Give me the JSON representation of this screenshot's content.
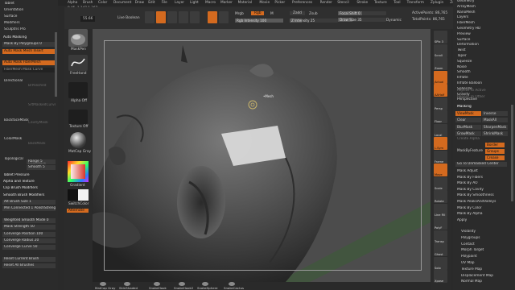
{
  "menu": [
    "Alpha",
    "Brush",
    "Color",
    "Document",
    "Draw",
    "Edit",
    "File",
    "Layer",
    "Light",
    "Macro",
    "Marker",
    "Material",
    "Movie",
    "Picker",
    "Preferences",
    "Render",
    "Stencil",
    "Stroke",
    "Texture",
    "Tool",
    "Transform",
    "Zplugin",
    "Zscript"
  ],
  "coords": "0.45 ·1.147,1.367",
  "topbar": {
    "value_box": "55.66",
    "live_boolean": "Live Boolean",
    "mrgb": "Mrgb",
    "rgb": "Rgb",
    "m": "M",
    "rgb_intensity": "Rgb Intensity 100",
    "zadd": "Zadd",
    "zsub": "Zsub",
    "z_intensity": "Z Intensity 25",
    "focal_shift": "Focal Shift 0",
    "draw_size": "Draw Size 35",
    "dynamic": "Dynamic",
    "active_points": "ActivePoints: 86,765",
    "total_points": "TotalPoints: 86,765"
  },
  "left_panel": {
    "rows": [
      {
        "label": "Tablet",
        "style": "plain"
      },
      {
        "label": "Orientation",
        "style": "plain"
      },
      {
        "label": "Surface",
        "style": "plain"
      },
      {
        "label": "Modifiers",
        "style": "plain"
      },
      {
        "label": "Sculptris Pro",
        "style": "plain"
      },
      {
        "label": "Auto Masking",
        "style": "sep"
      },
      {
        "label": "Mask By Polygroups 0",
        "style": "bar"
      },
      {
        "label": "Auto Mask Mesh Insert",
        "style": "orange"
      },
      {
        "label": "Auto Mask FiberMesh",
        "style": "orange"
      },
      {
        "label": "FiberMesh Mask Curve",
        "style": "dark"
      },
      {
        "label": "Directional",
        "style": "plain"
      },
      {
        "label": "BackfaceMask",
        "style": "plain"
      },
      {
        "label": "ColorMask",
        "style": "plain"
      },
      {
        "label": "Topological",
        "style": "plain"
      },
      {
        "label": "Range 5",
        "style": "bar"
      },
      {
        "label": "Smooth 5",
        "style": "bar"
      },
      {
        "label": "Tablet Pressure",
        "style": "sep"
      },
      {
        "label": "Alpha and Texture",
        "style": "sep"
      },
      {
        "label": "Clip Brush Modifiers",
        "style": "sep"
      },
      {
        "label": "Smooth Brush Modifiers",
        "style": "sep"
      },
      {
        "label": "Alt Brush Size 1",
        "style": "bar"
      },
      {
        "label": "Min Connected 1 PolishStrength",
        "style": "bar"
      },
      {
        "label": "Weighted Smooth Mode 0",
        "style": "bar"
      },
      {
        "label": "Mask Strength 50",
        "style": "bar"
      },
      {
        "label": "Converge Position 100",
        "style": "bar"
      },
      {
        "label": "Converge Radius 20",
        "style": "bar"
      },
      {
        "label": "Converge Curve 50",
        "style": "bar"
      },
      {
        "label": "Reset Current Brush",
        "style": "bar"
      },
      {
        "label": "Reset All Brushes",
        "style": "bar"
      }
    ],
    "dim_labels": [
      "BrPolished",
      "SrtMaskedCurve",
      "CavityMask",
      "BackMask",
      "ColorMask"
    ]
  },
  "shelf": {
    "brush_label": "MaskPen",
    "stroke_label": "FreeHand",
    "alpha_label": "Alpha Off",
    "texture_label": "Texture Off",
    "material_label": "MatCap Gray",
    "gradient_label": "Gradient",
    "switch_label": "SwitchColor",
    "alternate_label": "Alternate"
  },
  "viewport": {
    "cursor_label": "•Mesh"
  },
  "right_shelf": {
    "buttons": [
      "SPix 3",
      "Scroll",
      "Zoom",
      "Actual",
      "AAHalf",
      "Persp",
      "Floor",
      "Local",
      "L.Sym",
      "Frame",
      "Move",
      "Scale",
      "Rotate",
      "Line Fill",
      "PolyF",
      "Transp",
      "Ghost",
      "Solo",
      "Xpose"
    ]
  },
  "right_panel": {
    "top_rows": [
      "Geometry",
      "ArrayMesh",
      "NanoMesh",
      "Layers",
      "FiberMesh",
      "Geometry HD",
      "Preview",
      "Surface",
      "Deformation",
      "Twist",
      "Taper",
      "Squeeze",
      "Noise",
      "Smooth",
      "Inflate",
      "Inflate Balloon",
      "Spherize",
      "Gravity",
      "Perspective"
    ],
    "repair_rows": [
      "Repeat To Active",
      "Repeat To Other"
    ],
    "masking_header": "Masking",
    "mask_buttons": [
      {
        "left": "ViewMask",
        "right": "Inverse",
        "left_active": true
      },
      {
        "left": "Clear",
        "right": "MaskAll",
        "left_active": false
      },
      {
        "left": "BlurMask",
        "right": "SharpenMask",
        "left_active": false
      },
      {
        "left": "GrowMask",
        "right": "ShrinkMask",
        "left_active": false
      }
    ],
    "create_alpha": "Create Alpha",
    "mask_by_feature": "MaskByFeature",
    "feature_buttons": [
      "Border",
      "Groups",
      "Crease"
    ],
    "unmasked_center": "Go To Unmasked Center",
    "mask_rows": [
      "Mask Adjust",
      "Mask By Fibers",
      "Mask By AO",
      "Mask By Cavity",
      "Mask By Smoothness",
      "Mask PeaksAndValleys",
      "Mask By Color",
      "Mask By Alpha",
      "Apply"
    ],
    "bottom_rows": [
      "Visibility",
      "Polygroups",
      "Contact",
      "Morph Target",
      "Polypaint",
      "UV Map",
      "Texture Map",
      "Displacement Map",
      "Normal Map"
    ]
  },
  "bottom_bar": [
    "MatCap Gray",
    "SkinShaded",
    "SnakeHook",
    "SnakeHook2",
    "SnakeSphere",
    "SnakeCactus"
  ],
  "colors": {
    "accent": "#d46a1f",
    "panel": "#2b2b2b",
    "viewport_bg": "#4c4c4c",
    "sculpt": "#5a5a5a"
  }
}
